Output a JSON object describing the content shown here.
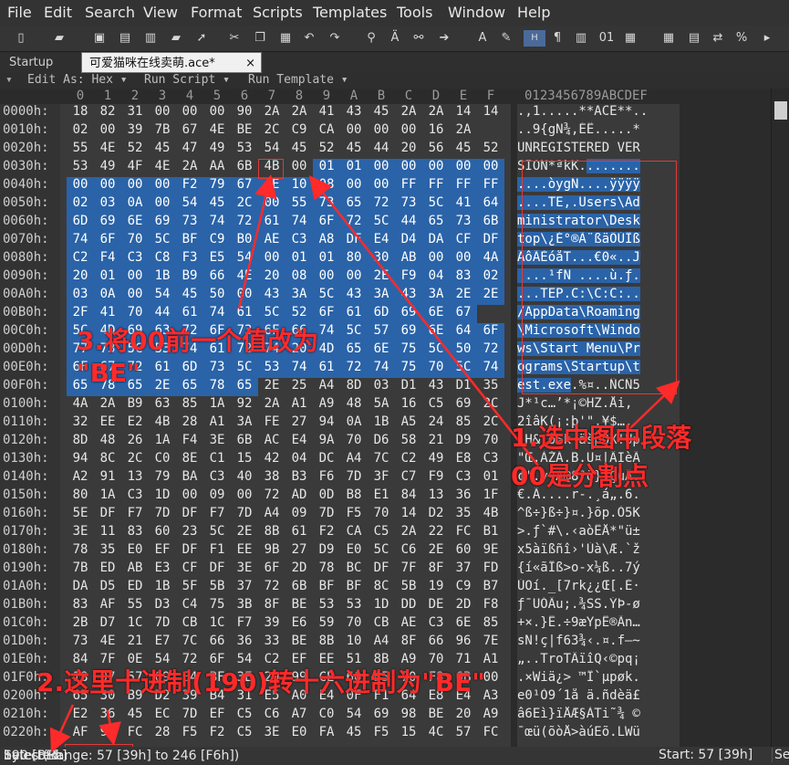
{
  "menu": [
    "File",
    "Edit",
    "Search",
    "View",
    "Format",
    "Scripts",
    "Templates",
    "Tools",
    "Window",
    "Help"
  ],
  "toolbar_icons": [
    "new-file-icon",
    "open-folder-icon",
    "save-icon",
    "save-all-icon",
    "save-copy-icon",
    "folder-icon",
    "open-arrow-icon",
    "cut-icon",
    "copy-icon",
    "paste-icon",
    "undo-icon",
    "redo-icon",
    "find-icon",
    "replace-icon",
    "find-in-files-icon",
    "goto-icon",
    "font-icon",
    "highlight-icon",
    "hex-mode-icon",
    "paragraph-icon",
    "columns-icon",
    "binary-icon",
    "grid-icon",
    "calculator-icon",
    "clipboard-icon",
    "swap-icon",
    "percent-icon",
    "more-icon"
  ],
  "tabs": [
    "Startup",
    "可爱猫咪在线卖萌.ace*"
  ],
  "tab_close": "×",
  "subbar": {
    "edit_as": "Edit As: Hex",
    "run_script": "Run Script",
    "run_template": "Run Template"
  },
  "columns": [
    "0",
    "1",
    "2",
    "3",
    "4",
    "5",
    "6",
    "7",
    "8",
    "9",
    "A",
    "B",
    "C",
    "D",
    "E",
    "F"
  ],
  "ascii_header": "0123456789ABCDEF",
  "rows": [
    {
      "offset": "0000h:",
      "hex": [
        "18",
        "82",
        "31",
        "00",
        "00",
        "00",
        "90",
        "2A",
        "2A",
        "41",
        "43",
        "45",
        "2A",
        "2A",
        "14",
        "14"
      ],
      "ascii": ".‚1.....**ACE**.."
    },
    {
      "offset": "0010h:",
      "hex": [
        "02",
        "00",
        "39",
        "7B",
        "67",
        "4E",
        "BE",
        "2C",
        "C9",
        "CA",
        "00",
        "00",
        "00",
        "16",
        "2A"
      ],
      "ascii": "..9{gN¾,ÉÊ.....*"
    },
    {
      "offset": "0020h:",
      "hex": [
        "55",
        "4E",
        "52",
        "45",
        "47",
        "49",
        "53",
        "54",
        "45",
        "52",
        "45",
        "44",
        "20",
        "56",
        "45",
        "52"
      ],
      "ascii": "UNREGISTERED VER"
    },
    {
      "offset": "0030h:",
      "hex": [
        "53",
        "49",
        "4F",
        "4E",
        "2A",
        "AA",
        "6B",
        "4B",
        "00",
        "01",
        "01",
        "00",
        "00",
        "00",
        "00",
        "00"
      ],
      "ascii": "SION*ªkK........"
    },
    {
      "offset": "0040h:",
      "hex": [
        "00",
        "00",
        "00",
        "00",
        "F2",
        "79",
        "67",
        "4E",
        "10",
        "08",
        "00",
        "00",
        "FF",
        "FF",
        "FF",
        "FF"
      ],
      "ascii": "....òygN....ÿÿÿÿ"
    },
    {
      "offset": "0050h:",
      "hex": [
        "02",
        "03",
        "0A",
        "00",
        "54",
        "45",
        "2C",
        "00",
        "55",
        "73",
        "65",
        "72",
        "73",
        "5C",
        "41",
        "64"
      ],
      "ascii": "....TE,.Users\\Ad"
    },
    {
      "offset": "0060h:",
      "hex": [
        "6D",
        "69",
        "6E",
        "69",
        "73",
        "74",
        "72",
        "61",
        "74",
        "6F",
        "72",
        "5C",
        "44",
        "65",
        "73",
        "6B"
      ],
      "ascii": "ministrator\\Desk"
    },
    {
      "offset": "0070h:",
      "hex": [
        "74",
        "6F",
        "70",
        "5C",
        "BF",
        "C9",
        "B0",
        "AE",
        "C3",
        "A8",
        "DF",
        "E4",
        "D4",
        "DA",
        "CF",
        "DF"
      ],
      "ascii": "top\\¿É°®Ã¨ßäÔÚÏß"
    },
    {
      "offset": "0080h:",
      "hex": [
        "C2",
        "F4",
        "C3",
        "C8",
        "F3",
        "E5",
        "54",
        "00",
        "01",
        "01",
        "80",
        "30",
        "AB",
        "00",
        "00",
        "4A"
      ],
      "ascii": "ÂôÃÈóåT...€0«..J"
    },
    {
      "offset": "0090h:",
      "hex": [
        "20",
        "01",
        "00",
        "1B",
        "B9",
        "66",
        "4E",
        "20",
        "08",
        "00",
        "00",
        "2E",
        "F9",
        "04",
        "83",
        "02"
      ],
      "ascii": " ...¹fN ....ù.ƒ."
    },
    {
      "offset": "00A0h:",
      "hex": [
        "03",
        "0A",
        "00",
        "54",
        "45",
        "50",
        "00",
        "43",
        "3A",
        "5C",
        "43",
        "3A",
        "43",
        "3A",
        "2E",
        "2E"
      ],
      "ascii": "...TEP.C:\\C:C:.."
    },
    {
      "offset": "00B0h:",
      "hex": [
        "2F",
        "41",
        "70",
        "44",
        "61",
        "74",
        "61",
        "5C",
        "52",
        "6F",
        "61",
        "6D",
        "69",
        "6E",
        "67"
      ],
      "ascii": "/AppData\\Roaming"
    },
    {
      "offset": "00C0h:",
      "hex": [
        "5C",
        "4D",
        "69",
        "63",
        "72",
        "6F",
        "73",
        "6F",
        "66",
        "74",
        "5C",
        "57",
        "69",
        "6E",
        "64",
        "6F"
      ],
      "ascii": "\\Microsoft\\Windo"
    },
    {
      "offset": "00D0h:",
      "hex": [
        "77",
        "73",
        "5C",
        "53",
        "74",
        "61",
        "72",
        "74",
        "20",
        "4D",
        "65",
        "6E",
        "75",
        "5C",
        "50",
        "72"
      ],
      "ascii": "ws\\Start Menu\\Pr"
    },
    {
      "offset": "00E0h:",
      "hex": [
        "6F",
        "67",
        "72",
        "61",
        "6D",
        "73",
        "5C",
        "53",
        "74",
        "61",
        "72",
        "74",
        "75",
        "70",
        "5C",
        "74"
      ],
      "ascii": "ograms\\Startup\\t"
    },
    {
      "offset": "00F0h:",
      "hex": [
        "65",
        "78",
        "65",
        "2E",
        "65",
        "78",
        "65",
        "2E",
        "25",
        "A4",
        "8D",
        "03",
        "D1",
        "43",
        "D1",
        "35"
      ],
      "ascii": "est.exe.%¤..ÑCÑ5"
    },
    {
      "offset": "0100h:",
      "hex": [
        "4A",
        "2A",
        "B9",
        "63",
        "85",
        "1A",
        "92",
        "2A",
        "A1",
        "A9",
        "48",
        "5A",
        "16",
        "C5",
        "69",
        "2C"
      ],
      "ascii": "J*¹c…’*¡©HZ.Åi,"
    },
    {
      "offset": "0110h:",
      "hex": [
        "32",
        "EE",
        "E2",
        "4B",
        "28",
        "A1",
        "3A",
        "FE",
        "27",
        "94",
        "0A",
        "1B",
        "A5",
        "24",
        "85",
        "2C"
      ],
      "ascii": "2îâK(¡:þ'\".¥$…,"
    },
    {
      "offset": "0120h:",
      "hex": [
        "8D",
        "48",
        "26",
        "1A",
        "F4",
        "3E",
        "6B",
        "AC",
        "E4",
        "9A",
        "70",
        "D6",
        "58",
        "21",
        "D9",
        "70"
      ],
      "ascii": ".H&.ô>k¬äšpÖX!Ùp"
    },
    {
      "offset": "0130h:",
      "hex": [
        "94",
        "8C",
        "2C",
        "C0",
        "8E",
        "C1",
        "15",
        "42",
        "04",
        "DC",
        "A4",
        "7C",
        "C2",
        "49",
        "E8",
        "C3"
      ],
      "ascii": "\"Œ,ÀŽÁ.B.Ü¤|ÂIèÃ"
    },
    {
      "offset": "0140h:",
      "hex": [
        "A2",
        "91",
        "13",
        "79",
        "BA",
        "C3",
        "40",
        "38",
        "B3",
        "F6",
        "7D",
        "3F",
        "C7",
        "F9",
        "C3",
        "01"
      ],
      "ascii": "¢'.yºÃ@8³ö}?ÇùÃ."
    },
    {
      "offset": "0150h:",
      "hex": [
        "80",
        "1A",
        "C3",
        "1D",
        "00",
        "09",
        "00",
        "72",
        "AD",
        "0D",
        "B8",
        "E1",
        "84",
        "13",
        "36",
        "1F"
      ],
      "ascii": "€.Ã....r-.¸á„.6."
    },
    {
      "offset": "0160h:",
      "hex": [
        "5E",
        "DF",
        "F7",
        "7D",
        "DF",
        "F7",
        "7D",
        "A4",
        "09",
        "7D",
        "F5",
        "70",
        "14",
        "D2",
        "35",
        "4B"
      ],
      "ascii": "^ß÷}ß÷}¤.}õp.Ò5K"
    },
    {
      "offset": "0170h:",
      "hex": [
        "3E",
        "11",
        "83",
        "60",
        "23",
        "5C",
        "2E",
        "8B",
        "61",
        "F2",
        "CA",
        "C5",
        "2A",
        "22",
        "FC",
        "B1"
      ],
      "ascii": ">.ƒ`#\\.‹aòÊÅ*\"ü±"
    },
    {
      "offset": "0180h:",
      "hex": [
        "78",
        "35",
        "E0",
        "EF",
        "DF",
        "F1",
        "EE",
        "9B",
        "27",
        "D9",
        "E0",
        "5C",
        "C6",
        "2E",
        "60",
        "9E"
      ],
      "ascii": "x5àïßñî›'Ùà\\Æ.`ž"
    },
    {
      "offset": "0190h:",
      "hex": [
        "7B",
        "ED",
        "AB",
        "E3",
        "CF",
        "DF",
        "3E",
        "6F",
        "2D",
        "78",
        "BC",
        "DF",
        "7F",
        "8F",
        "37",
        "FD"
      ],
      "ascii": "{í«ãÏß>o-x¼ß..7ý"
    },
    {
      "offset": "01A0h:",
      "hex": [
        "DA",
        "D5",
        "ED",
        "1B",
        "5F",
        "5B",
        "37",
        "72",
        "6B",
        "BF",
        "BF",
        "8C",
        "5B",
        "19",
        "C9",
        "B7"
      ],
      "ascii": "ÚÕí._[7rk¿¿Œ[.É·"
    },
    {
      "offset": "01B0h:",
      "hex": [
        "83",
        "AF",
        "55",
        "D3",
        "C4",
        "75",
        "3B",
        "8F",
        "BE",
        "53",
        "53",
        "1D",
        "DD",
        "DE",
        "2D",
        "F8"
      ],
      "ascii": "ƒ¯UÓÄu;.¾SS.ÝÞ-ø"
    },
    {
      "offset": "01C0h:",
      "hex": [
        "2B",
        "D7",
        "1C",
        "7D",
        "CB",
        "1C",
        "F7",
        "39",
        "E6",
        "59",
        "70",
        "CB",
        "AE",
        "C3",
        "6E",
        "85"
      ],
      "ascii": "+×.}Ë.÷9æYpË®Ãn…"
    },
    {
      "offset": "01D0h:",
      "hex": [
        "73",
        "4E",
        "21",
        "E7",
        "7C",
        "66",
        "36",
        "33",
        "BE",
        "8B",
        "10",
        "A4",
        "8F",
        "66",
        "96",
        "7E"
      ],
      "ascii": "sN!ç|f63¾‹.¤.f–~"
    },
    {
      "offset": "01E0h:",
      "hex": [
        "84",
        "7F",
        "0E",
        "54",
        "72",
        "6F",
        "54",
        "C2",
        "EF",
        "EE",
        "51",
        "8B",
        "A9",
        "70",
        "71",
        "A1"
      ],
      "ascii": "„..TroTÂïîQ‹©pq¡"
    },
    {
      "offset": "01F0h:",
      "hex": [
        "18",
        "D7",
        "57",
        "69",
        "E4",
        "BF",
        "3E",
        "20",
        "99",
        "CE",
        "60",
        "B5",
        "70",
        "F8",
        "6B",
        "00"
      ],
      "ascii": ".×Wiä¿> ™Î`µpøk."
    },
    {
      "offset": "0200h:",
      "hex": [
        "65",
        "30",
        "B9",
        "D2",
        "39",
        "B4",
        "31",
        "E5",
        "A0",
        "E4",
        "0F",
        "F1",
        "64",
        "E8",
        "E4",
        "A3"
      ],
      "ascii": "e0¹Ò9´1å ä.ñdèä£"
    },
    {
      "offset": "0210h:",
      "hex": [
        "E2",
        "36",
        "45",
        "EC",
        "7D",
        "EF",
        "C5",
        "C6",
        "A7",
        "C0",
        "54",
        "69",
        "98",
        "BE",
        "20",
        "A9"
      ],
      "ascii": "â6Eì}ïÅÆ§ÀTi˜¾ ©"
    },
    {
      "offset": "0220h:",
      "hex": [
        "AF",
        "9F",
        "FC",
        "28",
        "F5",
        "F2",
        "C5",
        "3E",
        "E0",
        "FA",
        "45",
        "F5",
        "15",
        "4C",
        "57",
        "FC"
      ],
      "ascii": "¯œü(õòÅ>àúEõ.LWü"
    }
  ],
  "status": {
    "selected_prefix": "Selected: ",
    "selected_value": "190 [BEh]",
    "selected_suffix": " bytes (Range: 57 [39h] to 246 [F6h])",
    "start": "Start: 57 [39h]",
    "sel_abbr": "Se"
  },
  "annotations": {
    "step1_line1": "1.选中图中段落",
    "step1_line2": "00是分割点",
    "step2": "2.这里十进制(190)转十六进制为\"BE\"",
    "step3_line1": "3.将00前一个值改为",
    "step3_line2": "\"BE\""
  },
  "colors": {
    "selection": "#2a63a8",
    "annotation": "#ff2a2a",
    "highlight_box": "#e23a3a"
  }
}
